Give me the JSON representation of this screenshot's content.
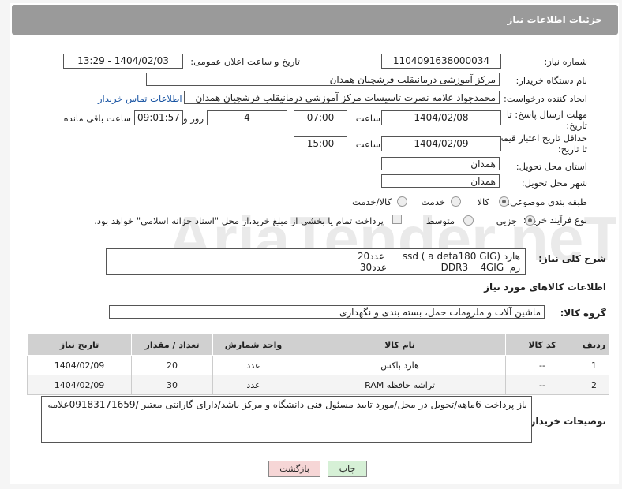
{
  "header": {
    "title": "جزئیات اطلاعات نیاز"
  },
  "fields": {
    "need_number_label": "شماره نیاز:",
    "need_number": "1104091638000034",
    "announce_label": "تاریخ و ساعت اعلان عمومی:",
    "announce_value": "1404/02/03 - 13:29",
    "buyer_org_label": "نام دستگاه خریدار:",
    "buyer_org": "مرکز آموزشی درمانیقلب فرشچیان همدان",
    "creator_label": "ایجاد کننده درخواست:",
    "creator": "محمدجواد علامه نصرت تاسیسات مرکز آموزشی درمانیقلب فرشچیان همدان",
    "contact_link": "اطلاعات تماس خریدار",
    "deadline_label_1": "مهلت ارسال پاسخ: تا",
    "deadline_label_2": "تاریخ:",
    "deadline_date": "1404/02/08",
    "time_label": "ساعت",
    "deadline_time": "07:00",
    "days_value": "4",
    "days_label": "روز و",
    "remaining_time": "09:01:57",
    "remaining_label": "ساعت باقی مانده",
    "validity_label_1": "حداقل تاریخ اعتبار قیمت:",
    "validity_label_2": "تا تاریخ:",
    "validity_date": "1404/02/09",
    "validity_time": "15:00",
    "province_label": "استان محل تحویل:",
    "province": "همدان",
    "city_label": "شهر محل تحویل:",
    "city": "همدان",
    "category_label": "طبقه بندی موضوعی:",
    "category_options": [
      "کالا",
      "خدمت",
      "کالا/خدمت"
    ],
    "category_selected": "کالا",
    "process_label": "نوع فرآیند خرید :",
    "process_options": [
      "جزیی",
      "متوسط"
    ],
    "process_selected": "جزیی",
    "payment_note": "پرداخت تمام یا بخشی از مبلغ خرید،از محل \"اسناد خزانه اسلامی\" خواهد بود."
  },
  "description": {
    "label": "شرح کلی نیاز:",
    "line1": "هارد (ssd ( a deta180 GIG      عدد20",
    "line2": "رم  DDR3    4GIG                  عدد30"
  },
  "goods": {
    "section_title": "اطلاعات کالاهای مورد نیاز",
    "group_label": "گروه کالا:",
    "group_value": "ماشین آلات و ملزومات حمل، بسته بندی و نگهداری",
    "columns": [
      "ردیف",
      "کد کالا",
      "نام کالا",
      "واحد شمارش",
      "تعداد / مقدار",
      "تاریخ نیاز"
    ],
    "rows": [
      {
        "idx": "1",
        "code": "--",
        "name": "هارد باکس",
        "unit": "عدد",
        "qty": "20",
        "date": "1404/02/09"
      },
      {
        "idx": "2",
        "code": "--",
        "name": "تراشه حافظه RAM",
        "unit": "عدد",
        "qty": "30",
        "date": "1404/02/09"
      }
    ]
  },
  "notes": {
    "label": "توضیحات خریدار:",
    "text": "باز پرداخت 6ماهه/تحویل در محل/مورد تایید مسئول فنی دانشگاه و مرکز باشد/دارای گارانتی معتبر /09183171659علامه"
  },
  "buttons": {
    "print": "چاپ",
    "back": "بازگشت"
  },
  "watermark": {
    "text": "AriaTender.neT"
  },
  "colors": {
    "header_bg": "#9a9a9a",
    "link": "#1a55a3",
    "back_btn_bg": "#f6d6d6",
    "print_btn_bg": "#d6f0d6"
  }
}
